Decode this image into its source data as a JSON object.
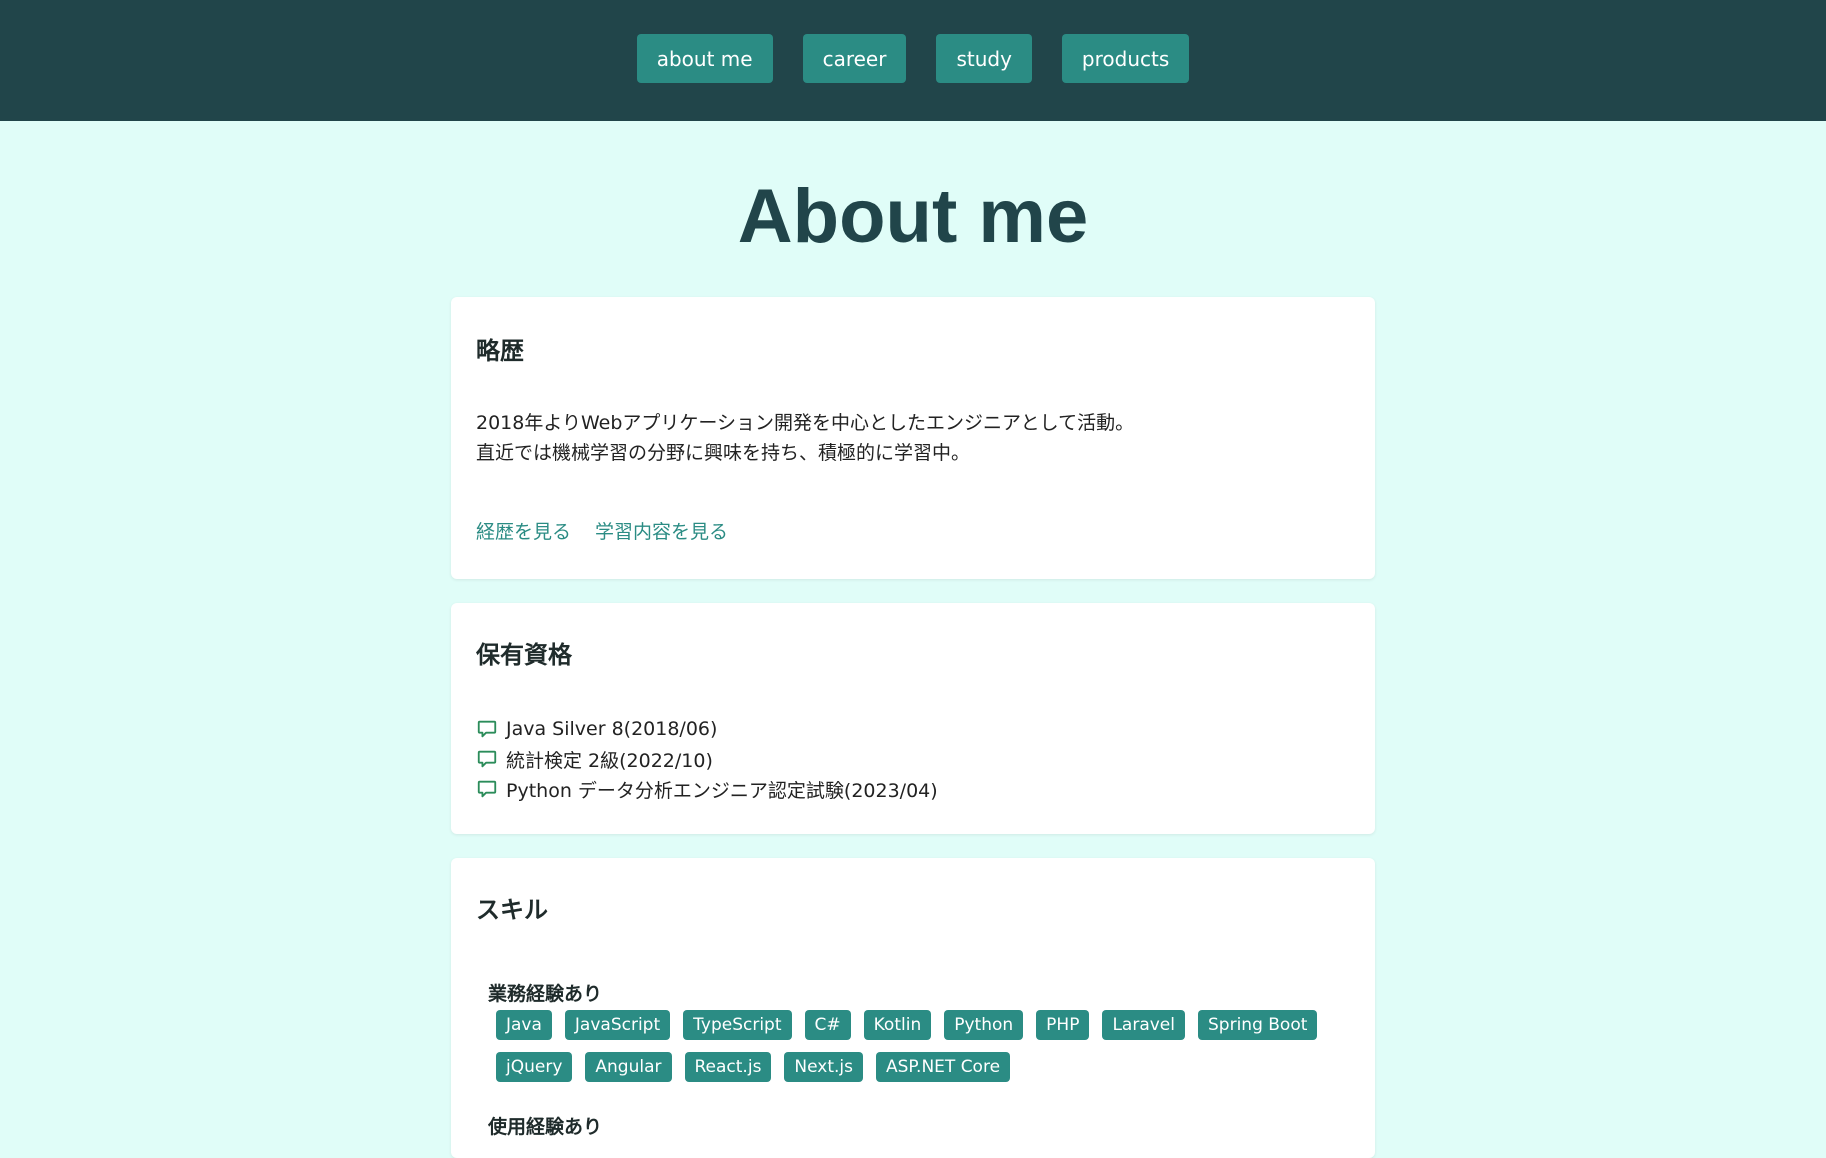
{
  "nav": {
    "items": [
      {
        "label": "about me"
      },
      {
        "label": "career"
      },
      {
        "label": "study"
      },
      {
        "label": "products"
      }
    ]
  },
  "page": {
    "title": "About me"
  },
  "bio": {
    "title": "略歴",
    "lines": [
      "2018年よりWebアプリケーション開発を中心としたエンジニアとして活動。",
      "直近では機械学習の分野に興味を持ち、積極的に学習中。"
    ],
    "links": [
      "経歴を見る",
      "学習内容を見る"
    ]
  },
  "qualifications": {
    "title": "保有資格",
    "icon": "chat-bubble-icon",
    "items": [
      "Java Silver 8(2018/06)",
      "統計検定 2級(2022/10)",
      "Python データ分析エンジニア認定試験(2023/04)"
    ]
  },
  "skills": {
    "title": "スキル",
    "groups": [
      {
        "label": "業務経験あり",
        "tags": [
          "Java",
          "JavaScript",
          "TypeScript",
          "C#",
          "Kotlin",
          "Python",
          "PHP",
          "Laravel",
          "Spring Boot",
          "jQuery",
          "Angular",
          "React.js",
          "Next.js",
          "ASP.NET Core"
        ]
      },
      {
        "label": "使用経験あり"
      }
    ]
  },
  "colors": {
    "header_bg": "#21454a",
    "page_bg": "#e0fdf8",
    "accent": "#2b8c84"
  }
}
